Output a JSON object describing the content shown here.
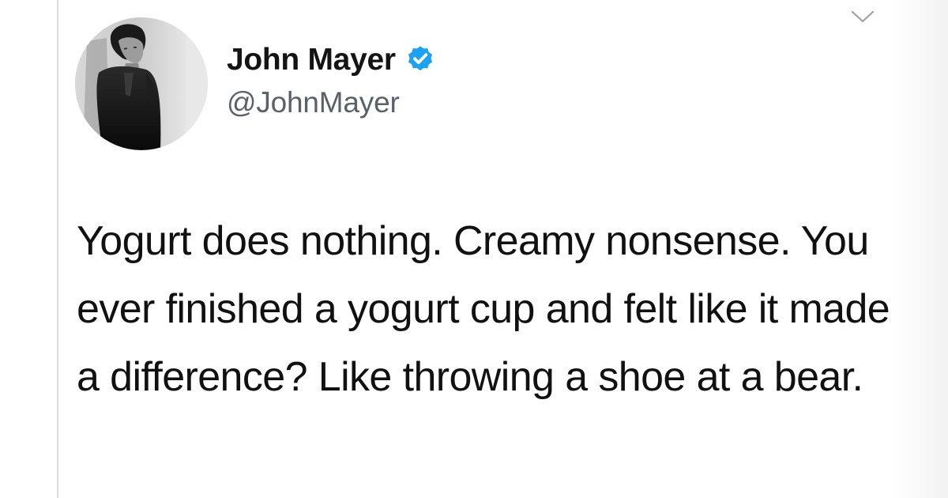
{
  "tweet": {
    "author": {
      "display_name": "John Mayer",
      "handle": "@JohnMayer",
      "verified": true,
      "avatar_icon": "person-portrait",
      "verified_icon": "verified-badge-icon"
    },
    "text": "Yogurt does nothing. Creamy nonsense. You ever finished a yogurt cup and felt like it made a difference? Like throwing a shoe at a bear.",
    "menu_icon": "chevron-down-icon"
  },
  "colors": {
    "accent_verified": "#1da1f2",
    "text_primary": "#141414",
    "text_secondary": "#5b6168",
    "background": "#ffffff"
  }
}
